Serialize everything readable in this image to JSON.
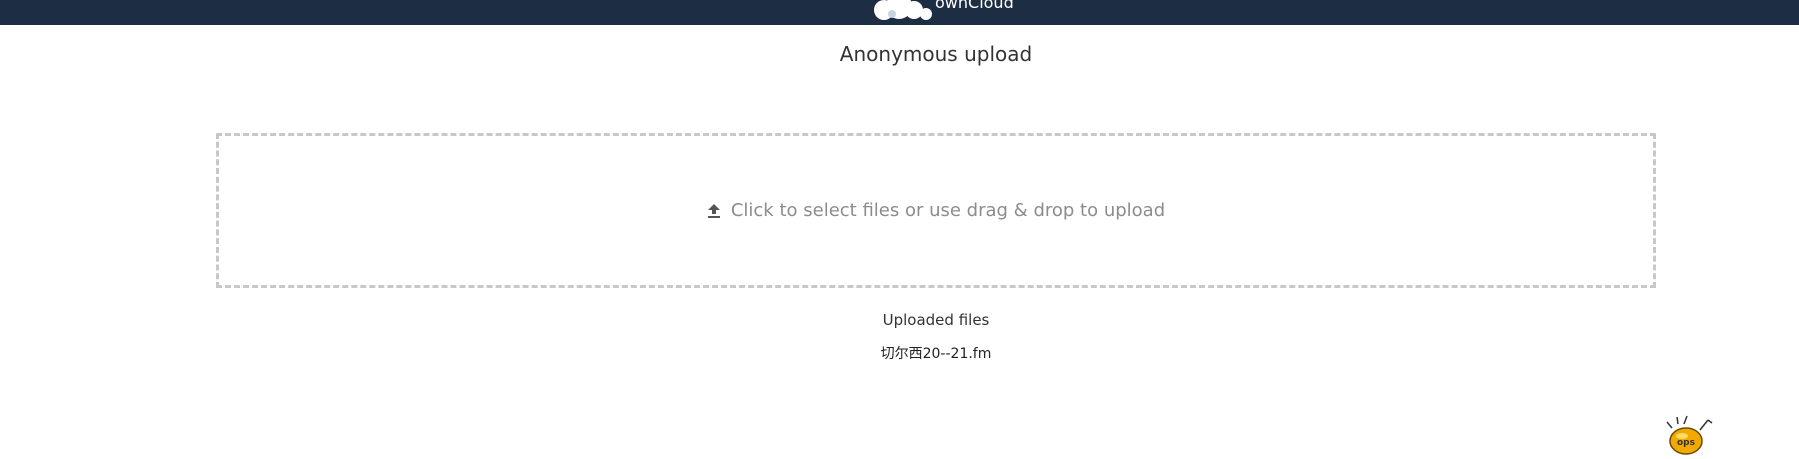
{
  "header": {
    "brand": "ownCloud",
    "background_color": "#1d2d44",
    "logo_icon": "owncloud-logo-icon"
  },
  "page": {
    "title": "Anonymous upload"
  },
  "dropzone": {
    "icon": "upload-icon",
    "label": "Click to select files or use drag & drop to upload",
    "border_color": "#c8c8c8"
  },
  "uploaded": {
    "title": "Uploaded files",
    "files": [
      "切尔西20--21.fm"
    ]
  },
  "badge": {
    "icon": "ops-mascot-icon",
    "text": "ops"
  }
}
